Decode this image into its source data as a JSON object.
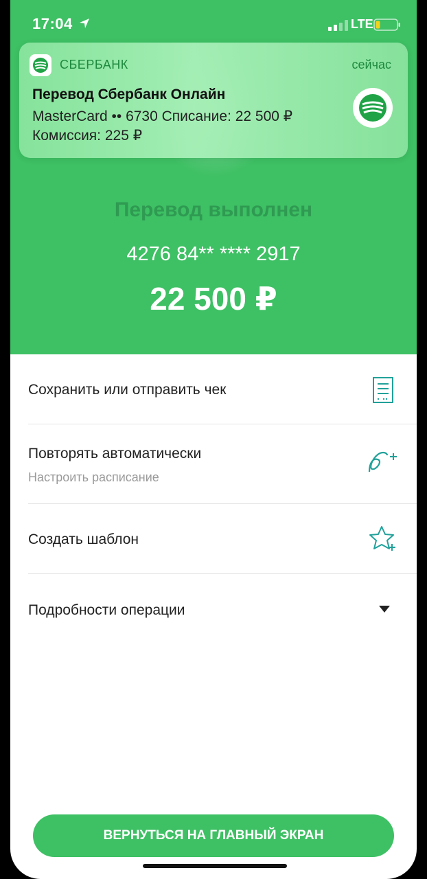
{
  "status_bar": {
    "time": "17:04",
    "network": "LTE"
  },
  "notification": {
    "app_name": "СБЕРБАНК",
    "time": "сейчас",
    "title": "Перевод Сбербанк Онлайн",
    "line1": "MasterCard •• 6730 Списание: 22 500 ₽",
    "line2": "Комиссия: 225 ₽"
  },
  "transfer": {
    "status": "Перевод выполнен",
    "card_number": "4276 84** **** 2917",
    "amount": "22 500 ₽"
  },
  "actions": [
    {
      "label": "Сохранить или отправить чек",
      "icon": "receipt-icon"
    },
    {
      "label": "Повторять автоматически",
      "sublabel": "Настроить расписание",
      "icon": "repeat-plus-icon"
    },
    {
      "label": "Создать шаблон",
      "icon": "star-plus-icon"
    },
    {
      "label": "Подробности операции",
      "icon": "caret-down-icon"
    }
  ],
  "bottom_button": {
    "label": "ВЕРНУТЬСЯ НА ГЛАВНЫЙ ЭКРАН"
  },
  "colors": {
    "brand_green": "#3ec064",
    "dark_green": "#2f9a52",
    "icon_green": "#21a19a",
    "text_dark": "#222222",
    "text_muted": "#9a9a9a"
  }
}
